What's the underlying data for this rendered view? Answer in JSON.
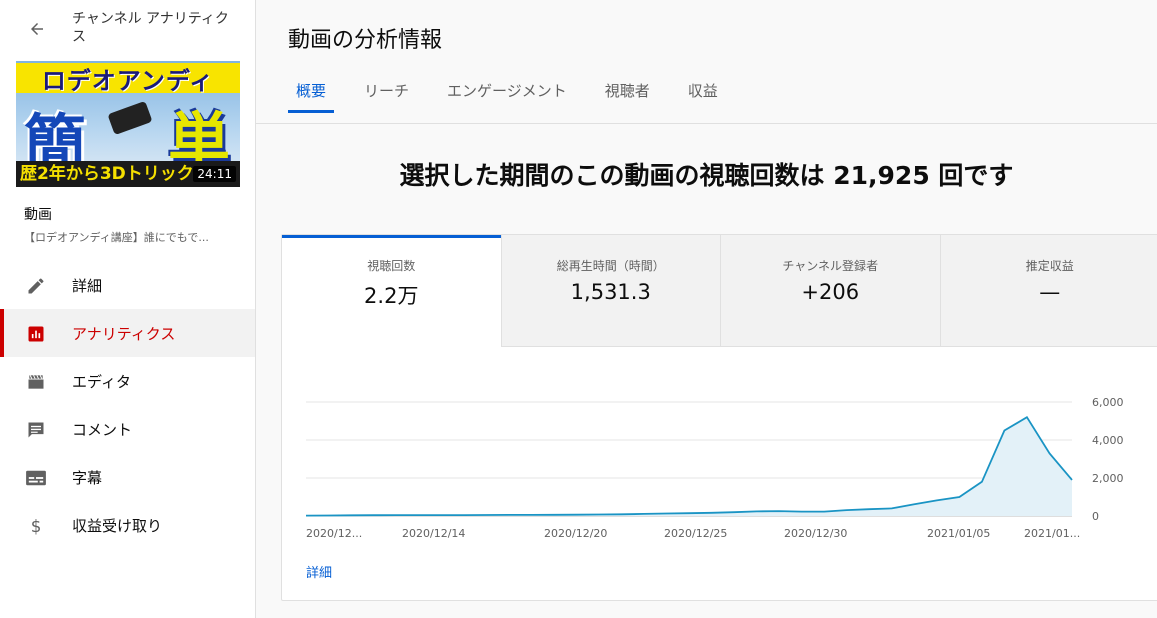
{
  "sidebar": {
    "back_label": "",
    "channel_title": "チャンネル アナリティクス",
    "thumbnail": {
      "top_text": "ロデオアンディ",
      "big_left": "簡",
      "big_right": "単",
      "bottom_text": "歴2年から3Dトリック",
      "duration": "24:11"
    },
    "video_label": "動画",
    "video_title": "【ロデオアンディ講座】誰にでもで...",
    "nav": [
      {
        "label": "詳細",
        "icon": "pencil-icon"
      },
      {
        "label": "アナリティクス",
        "icon": "analytics-icon",
        "active": true
      },
      {
        "label": "エディタ",
        "icon": "film-clapper-icon"
      },
      {
        "label": "コメント",
        "icon": "comment-icon"
      },
      {
        "label": "字幕",
        "icon": "subtitles-icon"
      },
      {
        "label": "収益受け取り",
        "icon": "dollar-icon"
      }
    ]
  },
  "main": {
    "page_title": "動画の分析情報",
    "tabs": [
      {
        "label": "概要",
        "active": true
      },
      {
        "label": "リーチ"
      },
      {
        "label": "エンゲージメント"
      },
      {
        "label": "視聴者"
      },
      {
        "label": "収益"
      }
    ],
    "headline": "選択した期間のこの動画の視聴回数は 21,925 回です",
    "metrics": [
      {
        "label": "視聴回数",
        "value": "2.2万",
        "active": true
      },
      {
        "label": "総再生時間（時間）",
        "value": "1,531.3"
      },
      {
        "label": "チャンネル登録者",
        "value": "+206"
      },
      {
        "label": "推定収益",
        "value": "—"
      }
    ],
    "details_link": "詳細"
  },
  "colors": {
    "accent_blue": "#065fd4",
    "active_red": "#cc0000",
    "line": "#1a94c4",
    "area": "#e3f1f8"
  },
  "chart_data": {
    "type": "area",
    "x_ticks": [
      "2020/12...",
      "2020/12/14",
      "2020/12/20",
      "2020/12/25",
      "2020/12/30",
      "2021/01/05",
      "2021/01..."
    ],
    "y_ticks": [
      "0",
      "2,000",
      "4,000",
      "6,000"
    ],
    "ylim": [
      0,
      6000
    ],
    "grid": true,
    "series": [
      {
        "values": [
          20,
          25,
          35,
          40,
          45,
          50,
          50,
          50,
          55,
          60,
          60,
          65,
          70,
          80,
          90,
          110,
          130,
          150,
          170,
          200,
          240,
          260,
          230,
          230,
          310,
          360,
          400,
          620,
          820,
          1000,
          1800,
          4500,
          5200,
          3300,
          1900
        ]
      }
    ]
  }
}
